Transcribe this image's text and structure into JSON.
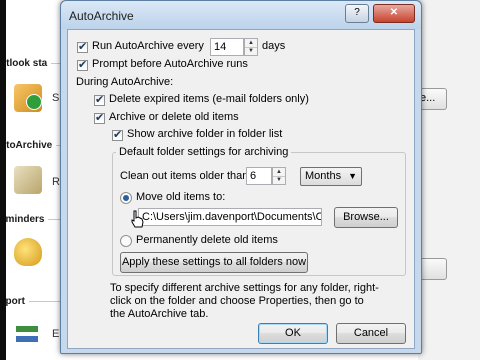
{
  "background": {
    "headings": [
      "utlook sta",
      "utoArchive",
      "eminders",
      "xport"
    ],
    "letters": [
      "S",
      "R",
      "E"
    ],
    "button_stub_label": "e..."
  },
  "dialog": {
    "title": "AutoArchive",
    "help_label": "?",
    "close_label": "✕",
    "run_autoarchive": {
      "checked": true,
      "label": "Run AutoArchive every",
      "value": "14",
      "unit": "days"
    },
    "prompt_before": {
      "checked": true,
      "label": "Prompt before AutoArchive runs"
    },
    "during_label": "During AutoArchive:",
    "delete_expired": {
      "checked": true,
      "label": "Delete expired items (e-mail folders only)"
    },
    "archive_or_delete": {
      "checked": true,
      "label": "Archive or delete old items"
    },
    "show_archive_folder": {
      "checked": true,
      "label": "Show archive folder in folder list"
    },
    "defaults_group": {
      "title": "Default folder settings for archiving",
      "clean_out_label": "Clean out items older than",
      "clean_out_value": "6",
      "period": "Months",
      "move_old": {
        "selected": true,
        "label": "Move old items to:"
      },
      "path_value": "C:\\Users\\jim.davenport\\Documents\\Ou",
      "browse_label": "Browse...",
      "permanently_delete": {
        "selected": false,
        "label": "Permanently delete old items"
      },
      "apply_all_label": "Apply these settings to all folders now"
    },
    "info_text": "To specify different archive settings for any folder, right-click on the folder and choose Properties, then go to the AutoArchive tab.",
    "ok_label": "OK",
    "cancel_label": "Cancel"
  },
  "colors": {
    "dialog_frame": "#c6d9ec",
    "client_bg": "#f0f0f0",
    "accent": "#3c7fb1"
  }
}
